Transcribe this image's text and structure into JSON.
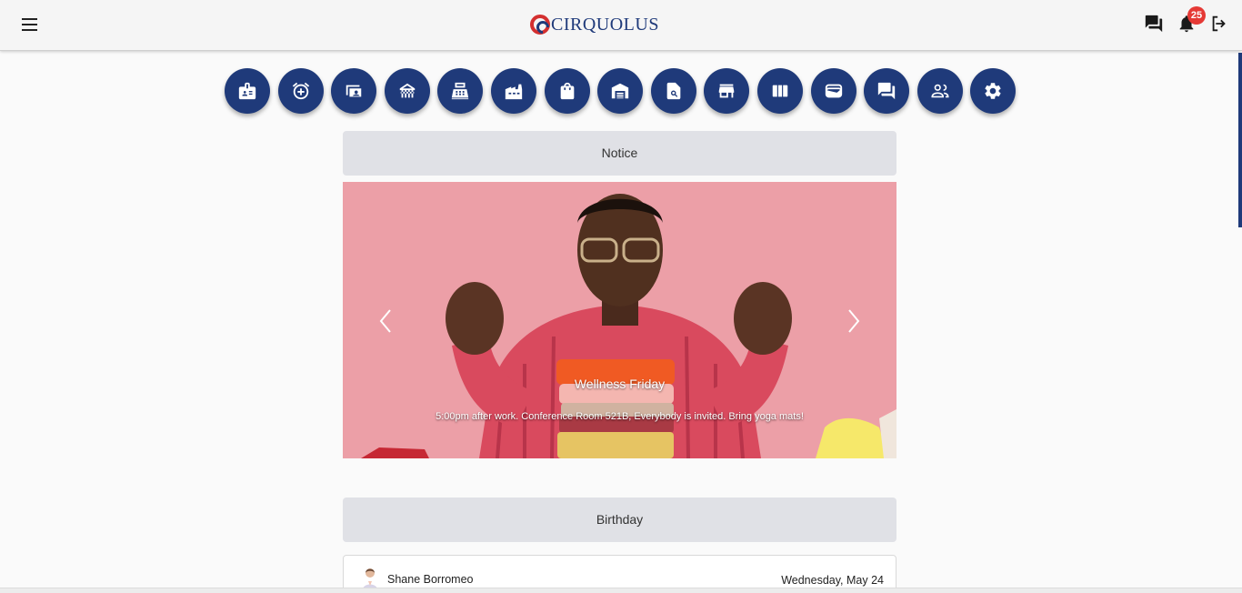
{
  "app": {
    "brand": "CIRQUOLUS",
    "colors": {
      "primary": "#1f3a7a",
      "accent": "#d32f2f",
      "badge": "#e53935",
      "section_header": "#e0e1e6",
      "banner_bg": "#ec9fa7"
    }
  },
  "topbar": {
    "menu_icon": "hamburger-icon",
    "chat_icon": "chat-icon",
    "notifications_icon": "bell-icon",
    "notifications_count": "25",
    "logout_icon": "logout-icon"
  },
  "nav": {
    "items": [
      {
        "icon": "id-card-icon"
      },
      {
        "icon": "alarm-add-icon"
      },
      {
        "icon": "contact-card-icon"
      },
      {
        "icon": "gate-icon"
      },
      {
        "icon": "cash-register-icon"
      },
      {
        "icon": "factory-icon"
      },
      {
        "icon": "shopping-bag-icon"
      },
      {
        "icon": "warehouse-icon"
      },
      {
        "icon": "document-search-icon"
      },
      {
        "icon": "storefront-icon"
      },
      {
        "icon": "columns-icon"
      },
      {
        "icon": "wallet-icon"
      },
      {
        "icon": "forum-icon"
      },
      {
        "icon": "people-icon"
      },
      {
        "icon": "settings-gear-icon"
      }
    ]
  },
  "notice": {
    "header": "Notice",
    "slide": {
      "title": "Wellness Friday",
      "text": "5:00pm after work. Conference Room 521B, Everybody is invited. Bring yoga mats!"
    },
    "prev_icon": "chevron-left-icon",
    "next_icon": "chevron-right-icon"
  },
  "birthday": {
    "header": "Birthday",
    "entries": [
      {
        "name": "Shane Borromeo",
        "date": "Wednesday, May 24"
      }
    ]
  }
}
